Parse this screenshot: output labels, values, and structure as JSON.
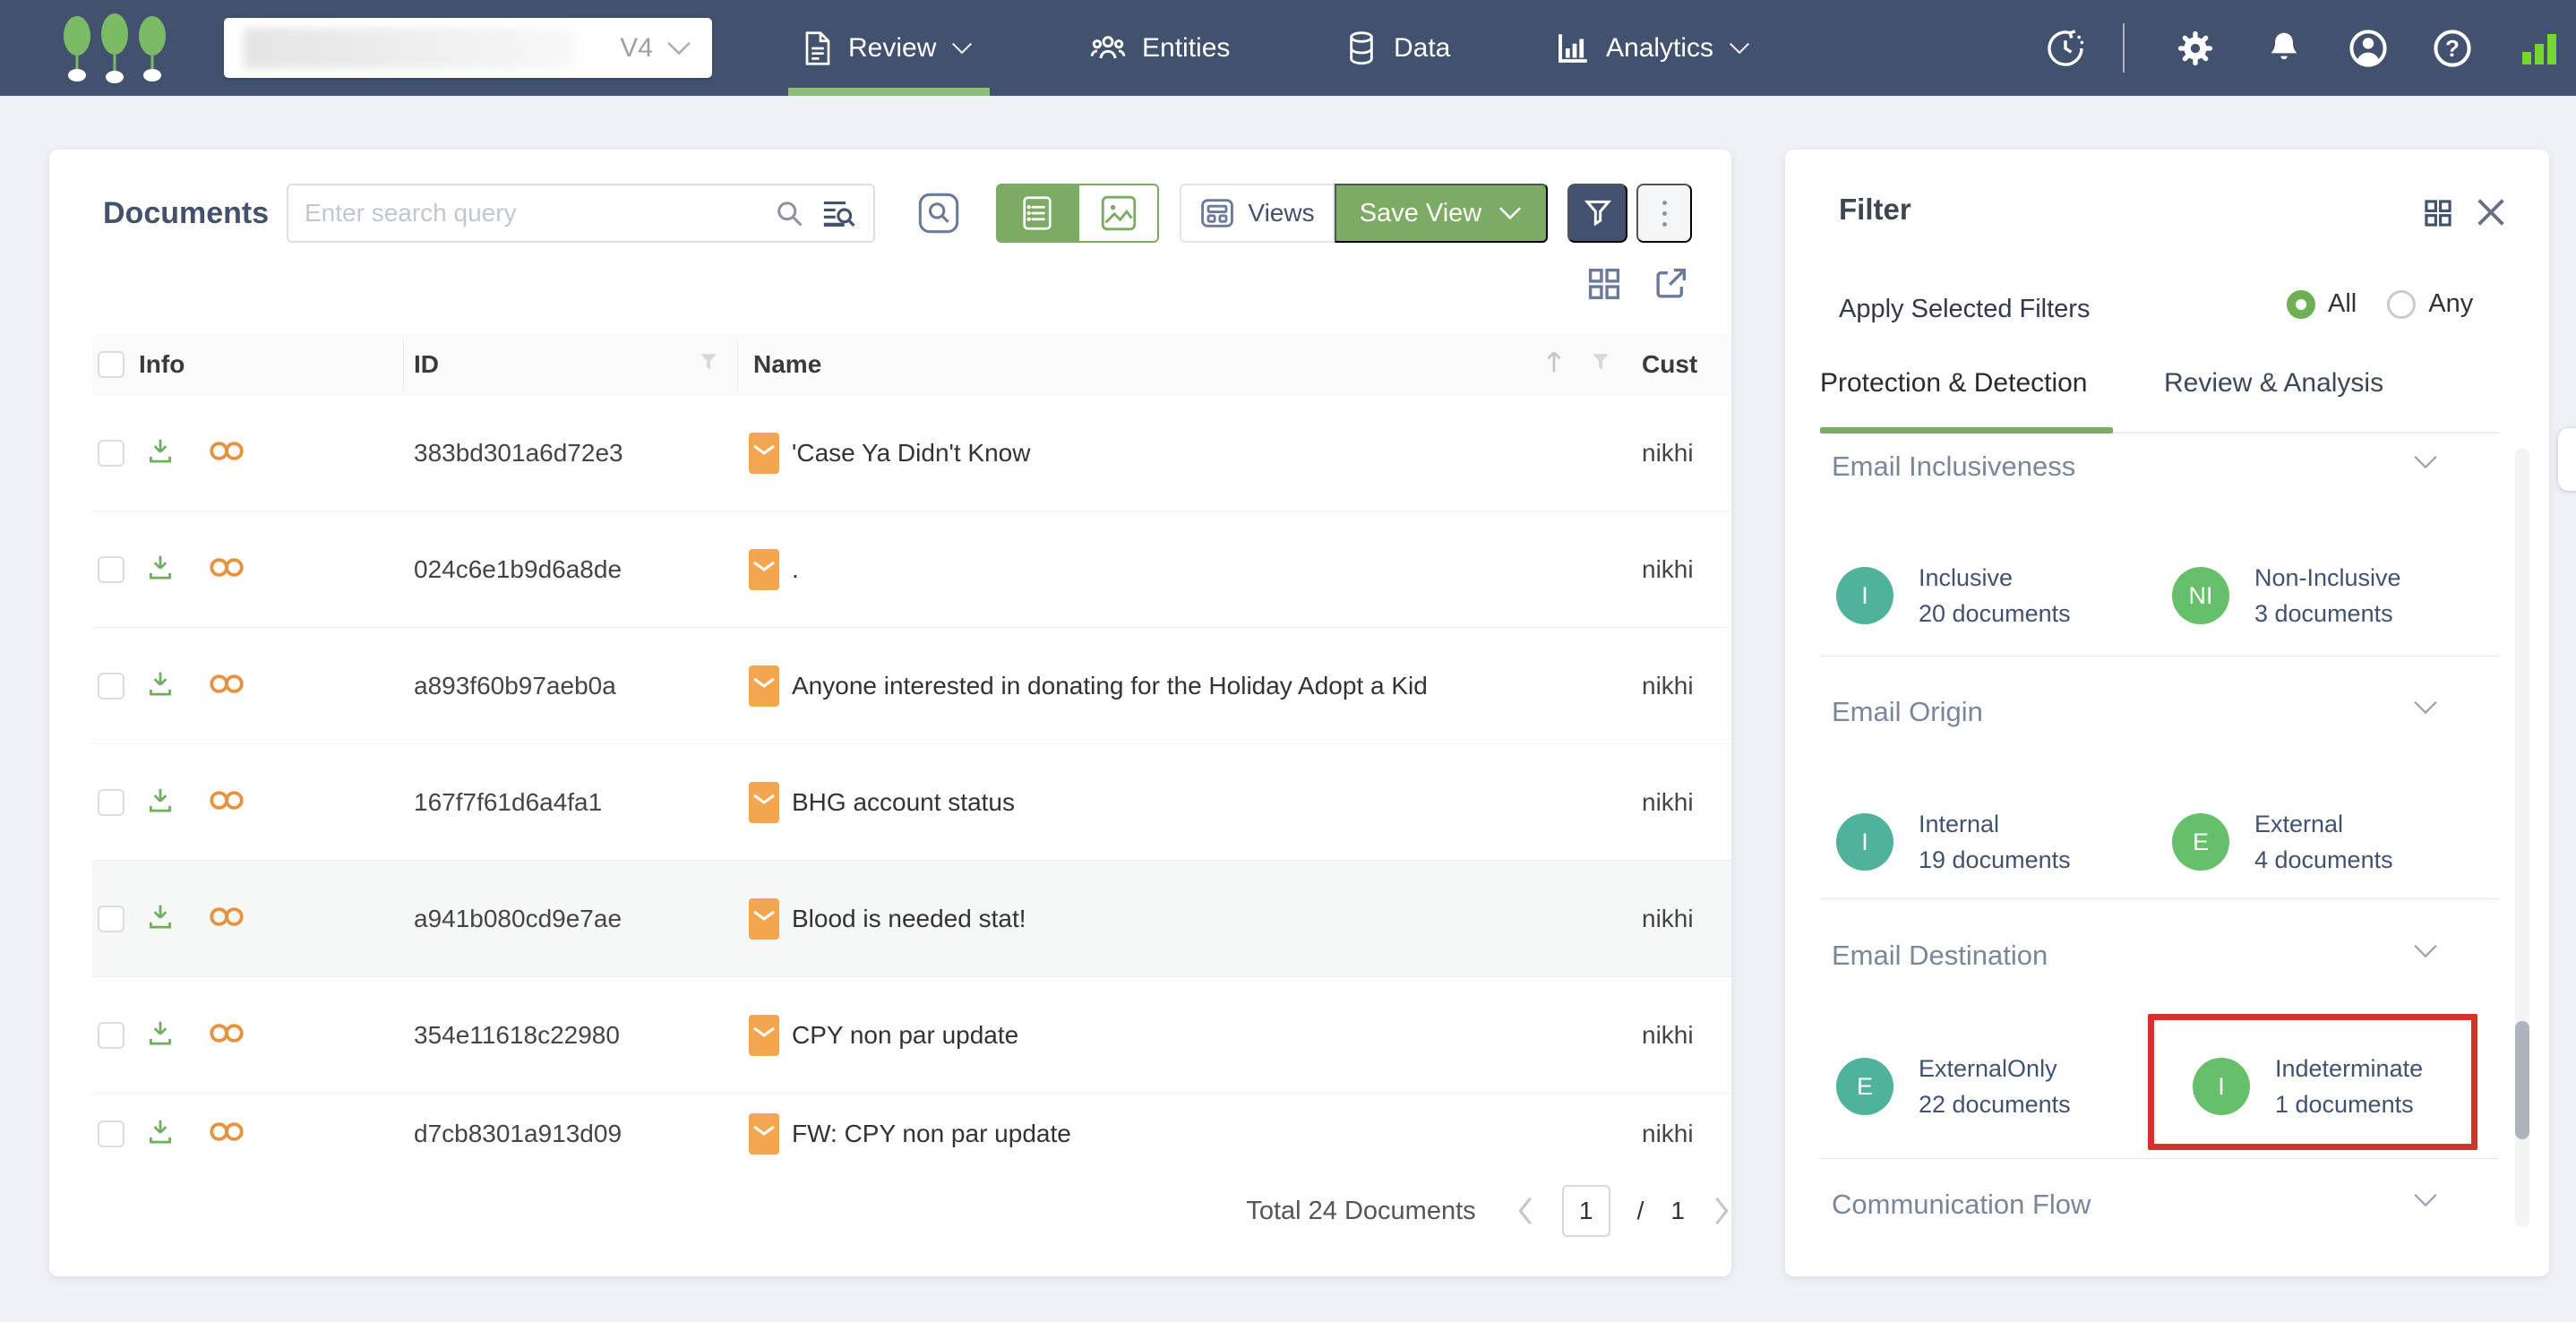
{
  "colors": {
    "navbar_bg": "#42526E",
    "accent_green": "#7CAB63",
    "nav_underline_green": "#8CBF73",
    "badge_teal": "#4FB39B",
    "badge_green": "#66BF6B",
    "annotation_red": "#D2342B",
    "icon_orange": "#E8923D",
    "envelope_orange": "#F2A64F",
    "download_green": "#6FAE5E",
    "signal_green": "#74D62E"
  },
  "navbar": {
    "version_label": "V4",
    "tabs": [
      {
        "label": "Review",
        "active": true
      },
      {
        "label": "Entities",
        "active": false
      },
      {
        "label": "Data",
        "active": false
      },
      {
        "label": "Analytics",
        "active": false
      }
    ]
  },
  "documents": {
    "title": "Documents",
    "search_placeholder": "Enter search query",
    "views_label": "Views",
    "save_view_label": "Save View",
    "headers": {
      "info": "Info",
      "id": "ID",
      "name": "Name",
      "custodian": "Cust"
    },
    "rows": [
      {
        "id": "383bd301a6d72e3",
        "name": "'Case Ya Didn't Know",
        "custodian": "nikhi"
      },
      {
        "id": "024c6e1b9d6a8de",
        "name": ".",
        "custodian": "nikhi"
      },
      {
        "id": "a893f60b97aeb0a",
        "name": "Anyone interested in donating for the Holiday Adopt a Kid",
        "custodian": "nikhi"
      },
      {
        "id": "167f7f61d6a4fa1",
        "name": "BHG account status",
        "custodian": "nikhi"
      },
      {
        "id": "a941b080cd9e7ae",
        "name": "Blood is needed stat!",
        "custodian": "nikhi"
      },
      {
        "id": "354e11618c22980",
        "name": "CPY non par update",
        "custodian": "nikhi"
      },
      {
        "id": "d7cb8301a913d09",
        "name": "FW: CPY non par update",
        "custodian": "nikhi"
      }
    ],
    "footer": {
      "total": "Total 24 Documents",
      "page": "1",
      "separator": "/",
      "pages": "1"
    }
  },
  "filter": {
    "title": "Filter",
    "apply_label": "Apply Selected Filters",
    "option_all": "All",
    "option_any": "Any",
    "tabs": [
      {
        "label": "Protection & Detection",
        "active": true
      },
      {
        "label": "Review & Analysis",
        "active": false
      }
    ],
    "sections": [
      {
        "title": "Email Inclusiveness",
        "items": [
          {
            "badge": "I",
            "color": "#4FB39B",
            "label": "Inclusive",
            "count": "20 documents"
          },
          {
            "badge": "NI",
            "color": "#66BF6B",
            "label": "Non-Inclusive",
            "count": "3 documents"
          }
        ]
      },
      {
        "title": "Email Origin",
        "items": [
          {
            "badge": "I",
            "color": "#4FB39B",
            "label": "Internal",
            "count": "19 documents"
          },
          {
            "badge": "E",
            "color": "#66BF6B",
            "label": "External",
            "count": "4 documents"
          }
        ]
      },
      {
        "title": "Email Destination",
        "items": [
          {
            "badge": "E",
            "color": "#4FB39B",
            "label": "ExternalOnly",
            "count": "22 documents"
          },
          {
            "badge": "I",
            "color": "#66BF6B",
            "label": "Indeterminate",
            "count": "1 documents",
            "annotated": true
          }
        ]
      },
      {
        "title": "Communication Flow",
        "items": []
      }
    ]
  }
}
